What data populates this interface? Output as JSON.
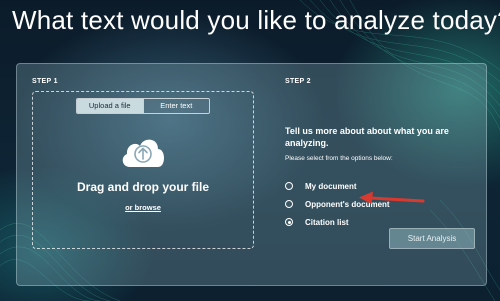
{
  "page_title": "What text would you like to analyze today?",
  "step1": {
    "label": "STEP 1",
    "tabs": [
      {
        "label": "Upload a file",
        "active": true
      },
      {
        "label": "Enter text",
        "active": false
      }
    ],
    "icon": "cloud-upload-icon",
    "drag_text": "Drag and drop your file",
    "browse_link": "or browse"
  },
  "step2": {
    "label": "STEP 2",
    "prompt": "Tell us more about about what you are analyzing.",
    "hint": "Please select from the options below:",
    "options": [
      {
        "label": "My document",
        "selected": false
      },
      {
        "label": "Opponent's document",
        "selected": false
      },
      {
        "label": "Citation list",
        "selected": true
      }
    ]
  },
  "start_button": "Start Analysis",
  "colors": {
    "accent_arrow": "#d93a2f",
    "background": "#0b1c2a"
  }
}
